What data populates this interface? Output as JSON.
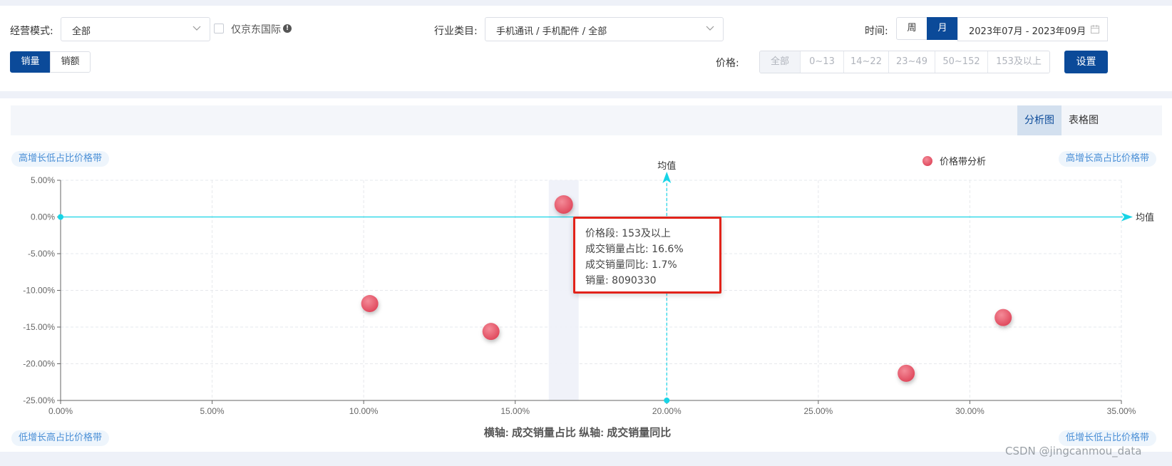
{
  "filters": {
    "mode_label": "经营模式:",
    "mode_value": "全部",
    "jd_intl_label": "仅京东国际",
    "industry_label": "行业类目:",
    "industry_value": "手机通讯 / 手机配件 / 全部",
    "time_label": "时间:",
    "time_week": "周",
    "time_month": "月",
    "time_selected": "月",
    "date_range": "2023年07月 - 2023年09月",
    "metric_tabs": [
      "销量",
      "销额"
    ],
    "metric_selected": "销量",
    "price_label": "价格:",
    "price_bands": [
      "全部",
      "0~13",
      "14~22",
      "23~49",
      "50~152",
      "153及以上"
    ],
    "price_selected": "全部",
    "setup_label": "设置"
  },
  "view_tabs": [
    "分析图",
    "表格图"
  ],
  "view_selected": "分析图",
  "quadrant_tags": {
    "top_left": "高增长低占比价格带",
    "top_right": "高增长高占比价格带",
    "bottom_left": "低增长高占比价格带",
    "bottom_right": "低增长低占比价格带"
  },
  "tooltip": {
    "row1": "价格段:  153及以上",
    "row2": "成交销量占比:  16.6%",
    "row3": "成交销量同比:  1.7%",
    "row4": "销量:  8090330"
  },
  "watermark": "CSDN @jingcanmou_data",
  "colors": {
    "primary": "#0b4a99",
    "point": "#e8596b",
    "mean_line": "#17d4e6",
    "tag_text": "#4a8fd6",
    "highlight": "#e2231a"
  },
  "chart_data": {
    "type": "scatter",
    "series": [
      {
        "name": "价格带分析",
        "points": [
          {
            "x": 10.2,
            "y": -11.8
          },
          {
            "x": 14.2,
            "y": -15.6
          },
          {
            "x": 16.6,
            "y": 1.7,
            "price_band": "153及以上",
            "volume": 8090330
          },
          {
            "x": 27.9,
            "y": -21.3
          },
          {
            "x": 31.1,
            "y": -13.7
          }
        ]
      }
    ],
    "xlim": [
      0,
      35
    ],
    "ylim": [
      -25,
      5
    ],
    "x_ticks": [
      "0.00%",
      "5.00%",
      "10.00%",
      "15.00%",
      "20.00%",
      "25.00%",
      "30.00%",
      "35.00%"
    ],
    "y_ticks": [
      "5.00%",
      "0.00%",
      "-5.00%",
      "-10.00%",
      "-15.00%",
      "-20.00%",
      "-25.00%"
    ],
    "mean_x": 20,
    "mean_y": 0,
    "mean_label_x": "均值",
    "mean_label_y": "均值",
    "legend": "价格带分析",
    "legend_position": "top-right",
    "axis_caption": "横轴: 成交销量占比  纵轴: 成交销量同比",
    "grid": true
  }
}
